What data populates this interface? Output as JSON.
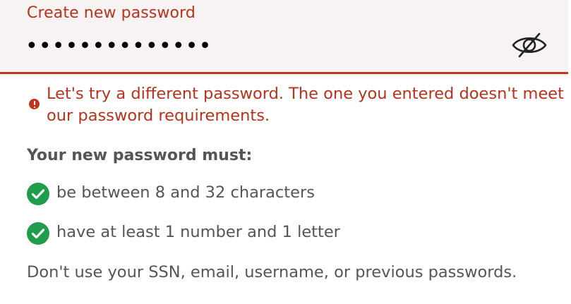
{
  "password_field": {
    "label": "Create new password",
    "masked_value": "••••••••••••••",
    "visibility_toggle_icon": "eye-off-icon"
  },
  "error": {
    "icon": "alert-circle-icon",
    "message": "Let's try a different password. The one you entered doesn't meet our password requirements."
  },
  "requirements": {
    "heading": "Your new password must:",
    "items": [
      {
        "label": "be between 8 and 32 characters",
        "met": true,
        "icon": "check-circle-icon"
      },
      {
        "label": "have at least 1 number and 1 letter",
        "met": true,
        "icon": "check-circle-icon"
      }
    ],
    "note": "Don't use your SSN, email, username, or previous passwords."
  },
  "colors": {
    "error_red": "#c2351c",
    "success_green": "#1f9d4c",
    "field_background": "#f7f3f2",
    "text_gray": "#555555"
  }
}
